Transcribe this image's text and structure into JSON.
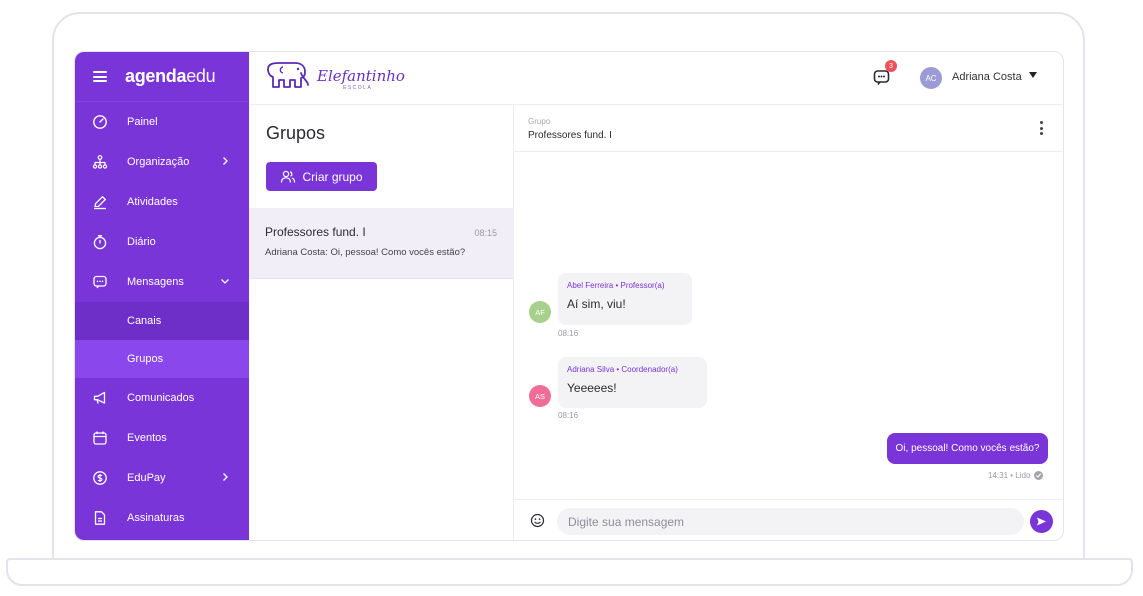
{
  "sidebar": {
    "brand_bold": "agenda",
    "brand_light": "edu",
    "items": [
      {
        "label": "Painel",
        "icon": "gauge-icon"
      },
      {
        "label": "Organização",
        "icon": "org-chart-icon"
      },
      {
        "label": "Atividades",
        "icon": "pencil-icon"
      },
      {
        "label": "Diário",
        "icon": "stopwatch-icon"
      },
      {
        "label": "Mensagens",
        "icon": "chat-icon"
      },
      {
        "label": "Canais"
      },
      {
        "label": "Grupos"
      },
      {
        "label": "Comunicados",
        "icon": "megaphone-icon"
      },
      {
        "label": "Eventos",
        "icon": "calendar-icon"
      },
      {
        "label": "EduPay",
        "icon": "dollar-icon"
      },
      {
        "label": "Assinaturas",
        "icon": "document-icon"
      }
    ]
  },
  "topbar": {
    "school_name": "Elefantinho",
    "school_sub": "ESCOLA",
    "notification_count": "3",
    "user_initials": "AC",
    "user_name": "Adriana Costa"
  },
  "groups": {
    "title": "Grupos",
    "create_label": "Criar grupo",
    "list": [
      {
        "name": "Professores fund. I",
        "time": "08:15",
        "preview": "Adriana Costa: Oi, pessoa! Como vocês estão?"
      }
    ]
  },
  "chat": {
    "header_label": "Grupo",
    "header_title": "Professores fund. I",
    "messages": [
      {
        "initials": "AF",
        "sender": "Abel Ferreira • Professor(a)",
        "text": "Aí sim, viu!",
        "time": "08:16"
      },
      {
        "initials": "AS",
        "sender": "Adriana Silva • Coordenador(a)",
        "text": "Yeeeees!",
        "time": "08:16"
      }
    ],
    "outgoing": {
      "text": "Oi, pessoal! Como vocês estão?",
      "meta": "14:31 • Lido"
    },
    "input_placeholder": "Digite sua mensagem"
  },
  "colors": {
    "accent": "#7a35d8",
    "active_item": "#8a47ec",
    "avatar_af": "#a8d08d",
    "avatar_as": "#f06d97",
    "avatar_user": "#9b9bd6",
    "badge": "#f0515a"
  }
}
